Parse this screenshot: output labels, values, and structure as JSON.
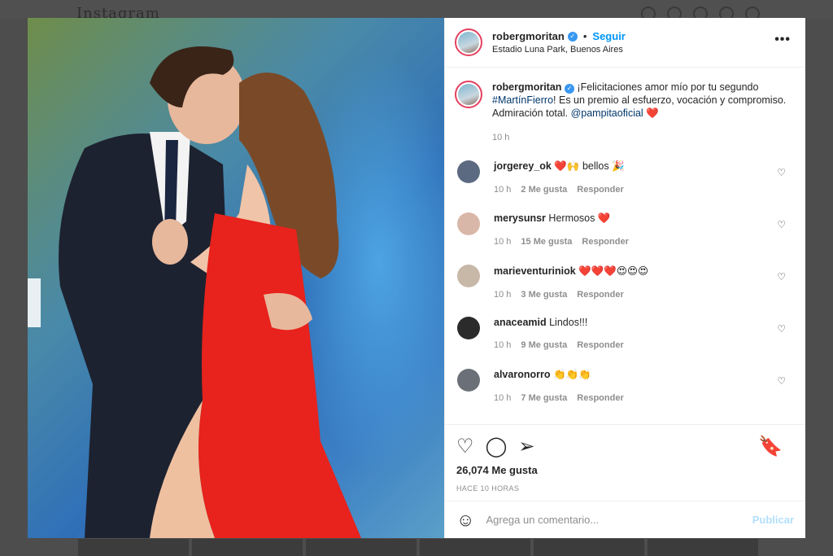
{
  "post": {
    "username": "robergmoritan",
    "follow_label": "Seguir",
    "location": "Estadio Luna Park, Buenos Aires",
    "caption_text": "¡Felicitaciones amor mío por tu segundo",
    "caption_hashtag": "#MartínFierro",
    "caption_rest": "! Es un premio al esfuerzo, vocación y compromiso. Admiración total.",
    "caption_mention": "@pampitaoficial",
    "caption_emoji": "❤️",
    "caption_time": "10 h",
    "likes": "26,074 Me gusta",
    "posted_ago": "HACE 10 HORAS"
  },
  "comments": [
    {
      "user": "jorgerey_ok",
      "text": "❤️🙌 bellos 🎉",
      "time": "10 h",
      "likes": "2 Me gusta",
      "reply": "Responder",
      "avatar_color": "#5b6a80"
    },
    {
      "user": "merysunsr",
      "text": "Hermosos ❤️",
      "time": "10 h",
      "likes": "15 Me gusta",
      "reply": "Responder",
      "avatar_color": "#d9b7a8"
    },
    {
      "user": "marieventuriniok",
      "text": "❤️❤️❤️😍😍😍",
      "time": "10 h",
      "likes": "3 Me gusta",
      "reply": "Responder",
      "avatar_color": "#c8b8a8"
    },
    {
      "user": "anaceamid",
      "text": "Lindos!!!",
      "time": "10 h",
      "likes": "9 Me gusta",
      "reply": "Responder",
      "avatar_color": "#2b2b2b"
    },
    {
      "user": "alvaronorro",
      "text": "👏👏👏",
      "time": "10 h",
      "likes": "7 Me gusta",
      "reply": "Responder",
      "avatar_color": "#6b7078"
    }
  ],
  "composer": {
    "placeholder": "Agrega un comentario...",
    "publish_label": "Publicar"
  },
  "background": {
    "logo": "Instagram"
  }
}
